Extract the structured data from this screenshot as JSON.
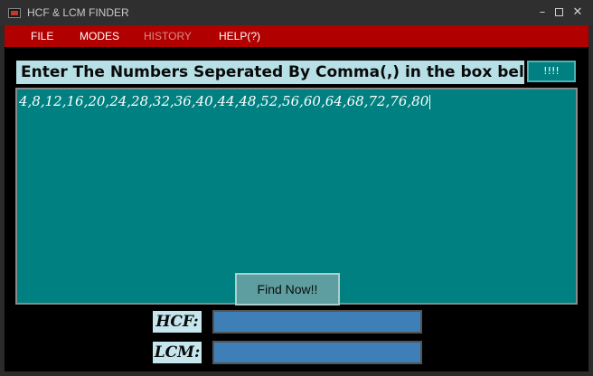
{
  "window": {
    "title": "HCF & LCM FINDER",
    "controls": {
      "minimize": "–",
      "close": "✕"
    }
  },
  "menu": [
    {
      "label": "FILE"
    },
    {
      "label": "MODES"
    },
    {
      "label": "HISTORY"
    },
    {
      "label": "HELP(?)"
    }
  ],
  "prompt": "Enter The Numbers Seperated By Comma(,) in the box below",
  "extra_button": "!!!!",
  "numbers_input": "4,8,12,16,20,24,28,32,36,40,44,48,52,56,60,64,68,72,76,80",
  "find_button": "Find Now!!",
  "results": {
    "hcf_label": "HCF:",
    "hcf_value": "",
    "lcm_label": "LCM:",
    "lcm_value": ""
  }
}
